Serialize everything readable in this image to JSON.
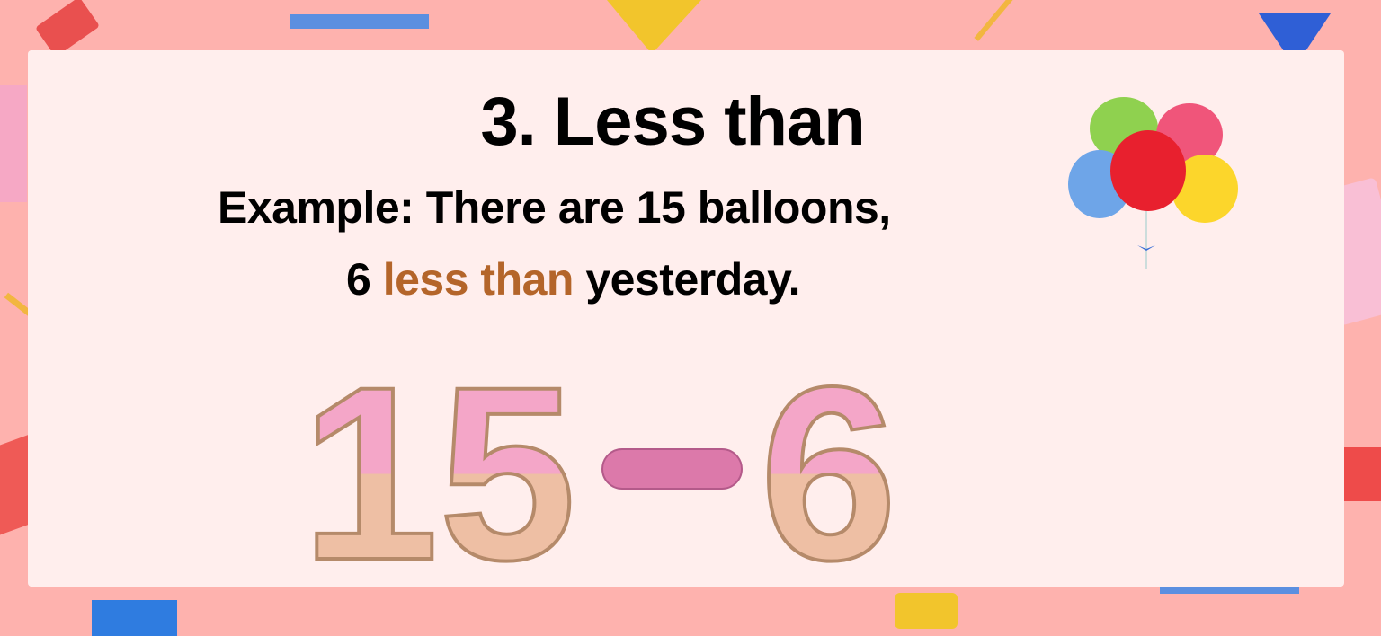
{
  "slide": {
    "title": "3. Less than",
    "example_line1": "Example: There are 15 balloons,",
    "example_line2_start": "6",
    "example_line2_highlight": "less than",
    "example_line2_end": "yesterday.",
    "expression": {
      "left": "15",
      "operator": "-",
      "right": "6"
    }
  },
  "colors": {
    "background": "#feb2ae",
    "card": "#ffeeed",
    "highlight": "#b4652a",
    "icing": "#f4a6c8",
    "cone": "#eebfa4"
  }
}
